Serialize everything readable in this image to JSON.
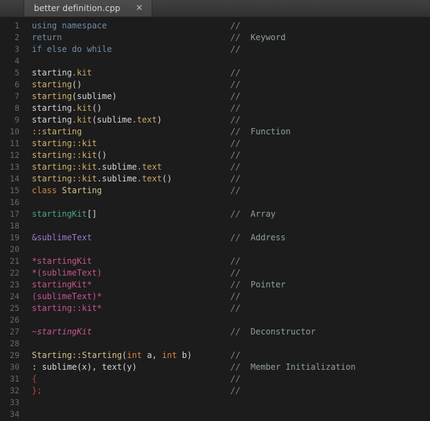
{
  "window": {
    "app": "Sublime Text",
    "background": "#1c1c1c"
  },
  "tabbar": {
    "tab_title": "better definition.cpp",
    "close_glyph": "×"
  },
  "editor": {
    "comment_prefix": "//",
    "total_lines": 34,
    "colors": {
      "background": "#1c1c1c",
      "gutter_text": "#6a6a6a",
      "comment": "#7d8a8a",
      "keyword": "#6f8ea8",
      "member": "#c7a86a",
      "function": "#d2b36b",
      "storage": "#d08a3e",
      "class_name": "#d9c08a",
      "array": "#4aa58c",
      "address": "#9a7bd0",
      "pointer": "#c7558f",
      "punctuation": "#b4453f",
      "plain": "#d6d6d6"
    },
    "lines": [
      {
        "n": 1,
        "comment": "//",
        "label": "",
        "tokens": [
          {
            "t": "using namespace",
            "c": "t-keyword"
          }
        ]
      },
      {
        "n": 2,
        "comment": "//",
        "label": "Keyword",
        "tokens": [
          {
            "t": "return",
            "c": "t-keyword"
          }
        ]
      },
      {
        "n": 3,
        "comment": "//",
        "label": "",
        "tokens": [
          {
            "t": "if else do while",
            "c": "t-keyword"
          }
        ]
      },
      {
        "n": 4,
        "comment": "",
        "label": "",
        "tokens": []
      },
      {
        "n": 5,
        "comment": "//",
        "label": "",
        "tokens": [
          {
            "t": "starting",
            "c": "t-plain"
          },
          {
            "t": ".kit",
            "c": "t-member"
          }
        ]
      },
      {
        "n": 6,
        "comment": "//",
        "label": "",
        "tokens": [
          {
            "t": "starting",
            "c": "t-func"
          },
          {
            "t": "()",
            "c": "t-plain"
          }
        ]
      },
      {
        "n": 7,
        "comment": "//",
        "label": "",
        "tokens": [
          {
            "t": "starting",
            "c": "t-func"
          },
          {
            "t": "(sublime)",
            "c": "t-plain"
          }
        ]
      },
      {
        "n": 8,
        "comment": "//",
        "label": "",
        "tokens": [
          {
            "t": "starting",
            "c": "t-plain"
          },
          {
            "t": ".kit",
            "c": "t-member"
          },
          {
            "t": "()",
            "c": "t-plain"
          }
        ]
      },
      {
        "n": 9,
        "comment": "//",
        "label": "",
        "tokens": [
          {
            "t": "starting",
            "c": "t-plain"
          },
          {
            "t": ".kit",
            "c": "t-member"
          },
          {
            "t": "(sublime",
            "c": "t-plain"
          },
          {
            "t": ".text",
            "c": "t-member"
          },
          {
            "t": ")",
            "c": "t-plain"
          }
        ]
      },
      {
        "n": 10,
        "comment": "//",
        "label": "Function",
        "tokens": [
          {
            "t": "::starting",
            "c": "t-func"
          }
        ]
      },
      {
        "n": 11,
        "comment": "//",
        "label": "",
        "tokens": [
          {
            "t": "starting::kit",
            "c": "t-func"
          }
        ]
      },
      {
        "n": 12,
        "comment": "//",
        "label": "",
        "tokens": [
          {
            "t": "starting::kit",
            "c": "t-func"
          },
          {
            "t": "()",
            "c": "t-plain"
          }
        ]
      },
      {
        "n": 13,
        "comment": "//",
        "label": "",
        "tokens": [
          {
            "t": "starting::kit",
            "c": "t-func"
          },
          {
            "t": ".sublime",
            "c": "t-plain"
          },
          {
            "t": ".text",
            "c": "t-member"
          }
        ]
      },
      {
        "n": 14,
        "comment": "//",
        "label": "",
        "tokens": [
          {
            "t": "starting::kit",
            "c": "t-func"
          },
          {
            "t": ".sublime",
            "c": "t-plain"
          },
          {
            "t": ".text",
            "c": "t-member"
          },
          {
            "t": "()",
            "c": "t-plain"
          }
        ]
      },
      {
        "n": 15,
        "comment": "//",
        "label": "",
        "tokens": [
          {
            "t": "class ",
            "c": "t-storage"
          },
          {
            "t": "Starting",
            "c": "t-class"
          }
        ]
      },
      {
        "n": 16,
        "comment": "",
        "label": "",
        "tokens": []
      },
      {
        "n": 17,
        "comment": "//",
        "label": "Array",
        "tokens": [
          {
            "t": "startingKit",
            "c": "t-array"
          },
          {
            "t": "[]",
            "c": "t-bracket"
          }
        ]
      },
      {
        "n": 18,
        "comment": "",
        "label": "",
        "tokens": []
      },
      {
        "n": 19,
        "comment": "//",
        "label": "Address",
        "tokens": [
          {
            "t": "&sublimeText",
            "c": "t-addr"
          }
        ]
      },
      {
        "n": 20,
        "comment": "",
        "label": "",
        "tokens": []
      },
      {
        "n": 21,
        "comment": "//",
        "label": "",
        "tokens": [
          {
            "t": "*startingKit",
            "c": "t-pointer"
          }
        ]
      },
      {
        "n": 22,
        "comment": "//",
        "label": "",
        "tokens": [
          {
            "t": "*(sublimeText)",
            "c": "t-pointer"
          }
        ]
      },
      {
        "n": 23,
        "comment": "//",
        "label": "Pointer",
        "tokens": [
          {
            "t": "startingKit*",
            "c": "t-pointer"
          }
        ]
      },
      {
        "n": 24,
        "comment": "//",
        "label": "",
        "tokens": [
          {
            "t": "(sublimeText)*",
            "c": "t-pointer"
          }
        ]
      },
      {
        "n": 25,
        "comment": "//",
        "label": "",
        "tokens": [
          {
            "t": "starting::kit*",
            "c": "t-pointer"
          }
        ]
      },
      {
        "n": 26,
        "comment": "",
        "label": "",
        "tokens": []
      },
      {
        "n": 27,
        "comment": "//",
        "label": "Deconstructor",
        "tokens": [
          {
            "t": "~startingKit",
            "c": "t-destruct"
          }
        ]
      },
      {
        "n": 28,
        "comment": "",
        "label": "",
        "tokens": []
      },
      {
        "n": 29,
        "comment": "//",
        "label": "",
        "tokens": [
          {
            "t": "Starting::Starting",
            "c": "t-class"
          },
          {
            "t": "(",
            "c": "t-plain"
          },
          {
            "t": "int",
            "c": "t-storage"
          },
          {
            "t": " a, ",
            "c": "t-plain"
          },
          {
            "t": "int",
            "c": "t-storage"
          },
          {
            "t": " b)",
            "c": "t-plain"
          }
        ]
      },
      {
        "n": 30,
        "comment": "//",
        "label": "Member Initialization",
        "tokens": [
          {
            "t": ": sublime(x), text(y)",
            "c": "t-plain"
          }
        ]
      },
      {
        "n": 31,
        "comment": "//",
        "label": "",
        "tokens": [
          {
            "t": "{",
            "c": "t-punct"
          }
        ]
      },
      {
        "n": 32,
        "comment": "//",
        "label": "",
        "tokens": [
          {
            "t": "};",
            "c": "t-punct"
          }
        ]
      },
      {
        "n": 33,
        "comment": "",
        "label": "",
        "tokens": []
      },
      {
        "n": 34,
        "comment": "",
        "label": "",
        "tokens": []
      }
    ]
  }
}
